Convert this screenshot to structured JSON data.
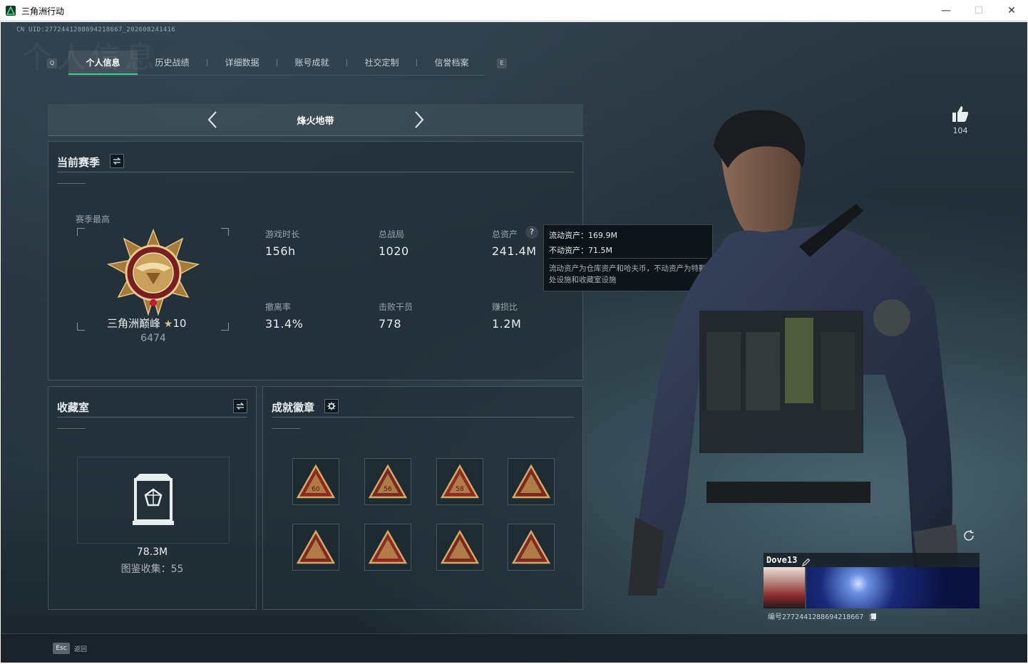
{
  "window": {
    "title": "三角洲行动",
    "minimize": "—",
    "maximize": "☐",
    "close": "✕"
  },
  "uid_line": "CN UID:2772441288694218667_202608241416",
  "ghost_title": "个人信息",
  "tabs": [
    {
      "label": "个人信息",
      "active": true
    },
    {
      "label": "历史战绩"
    },
    {
      "label": "详细数据"
    },
    {
      "label": "账号成就"
    },
    {
      "label": "社交定制"
    },
    {
      "label": "信誉档案"
    }
  ],
  "tab_keys": {
    "left": "Q",
    "right": "E"
  },
  "mode": {
    "title": "烽火地带"
  },
  "season": {
    "title": "当前赛季",
    "highest_label": "赛季最高",
    "rank_name": "三角洲巅峰",
    "rank_stars": "10",
    "rank_score": "6474",
    "stats": [
      {
        "label": "游戏时长",
        "value": "156h"
      },
      {
        "label": "总战局",
        "value": "1020"
      },
      {
        "label": "总资产",
        "value": "241.4M"
      },
      {
        "label": "撤离率",
        "value": "31.4%"
      },
      {
        "label": "击败干员",
        "value": "778"
      },
      {
        "label": "赚损比",
        "value": "1.2M"
      }
    ],
    "help_glyph": "?"
  },
  "tooltip": {
    "liquid": "流动资产：169.9M",
    "fixed": "不动资产：71.5M",
    "note": "流动资产为仓库资产和哈夫币，不动资产为特勤处设施和收藏室设施"
  },
  "collection": {
    "title": "收藏室",
    "value": "78.3M",
    "count_line": "图鉴收集：55"
  },
  "achievements": {
    "title": "成就徽章",
    "badges": [
      {
        "icon": "bag-badge-icon",
        "number": "60"
      },
      {
        "icon": "crown-badge-icon",
        "number": "56"
      },
      {
        "icon": "phone-badge-icon",
        "number": "58"
      },
      {
        "icon": "battery-badge-icon"
      },
      {
        "icon": "soldier-badge-icon"
      },
      {
        "icon": "boots-badge-icon"
      },
      {
        "icon": "prone-badge-icon"
      },
      {
        "icon": "squad-badge-icon"
      }
    ]
  },
  "profile": {
    "likes": "104",
    "name": "Dove13",
    "id": "编号2772441288694218667"
  },
  "footer": {
    "key": "Esc",
    "label": "返回"
  },
  "colors": {
    "accent": "#2fd08a",
    "panel": "#232f37",
    "text": "#e9eef0",
    "muted": "#98a4aa"
  }
}
